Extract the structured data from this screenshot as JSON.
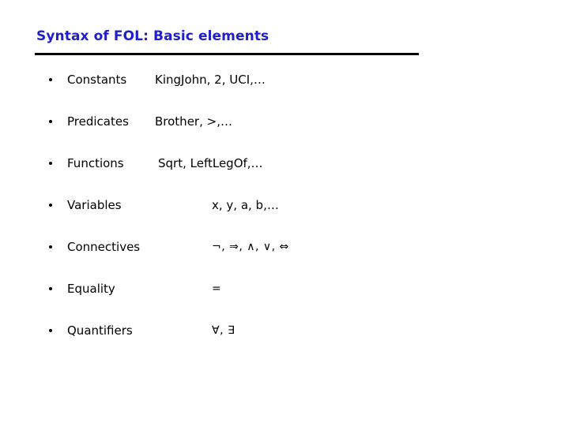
{
  "slide": {
    "title": "Syntax of FOL: Basic elements",
    "title_color": "#2020c8",
    "rule_color": "#000000",
    "background_color": "#ffffff",
    "text_color": "#000000"
  },
  "bullets": [
    {
      "label": "Constants",
      "value": "KingJohn, 2, UCI,…",
      "layout": "inline"
    },
    {
      "label": "Predicates",
      "value": "Brother, >,…",
      "layout": "inline"
    },
    {
      "label": "Functions",
      "value": "Sqrt, LeftLegOf,…",
      "layout": "inline"
    },
    {
      "label": "Variables",
      "value": "x, y, a, b,…",
      "layout": "columnar"
    },
    {
      "label": "Connectives",
      "value": "¬, ⇒, ∧, ∨, ⇔",
      "layout": "columnar"
    },
    {
      "label": "Equality",
      "value": "=",
      "layout": "columnar"
    },
    {
      "label": "Quantifiers",
      "value": "∀, ∃",
      "layout": "columnar"
    }
  ]
}
